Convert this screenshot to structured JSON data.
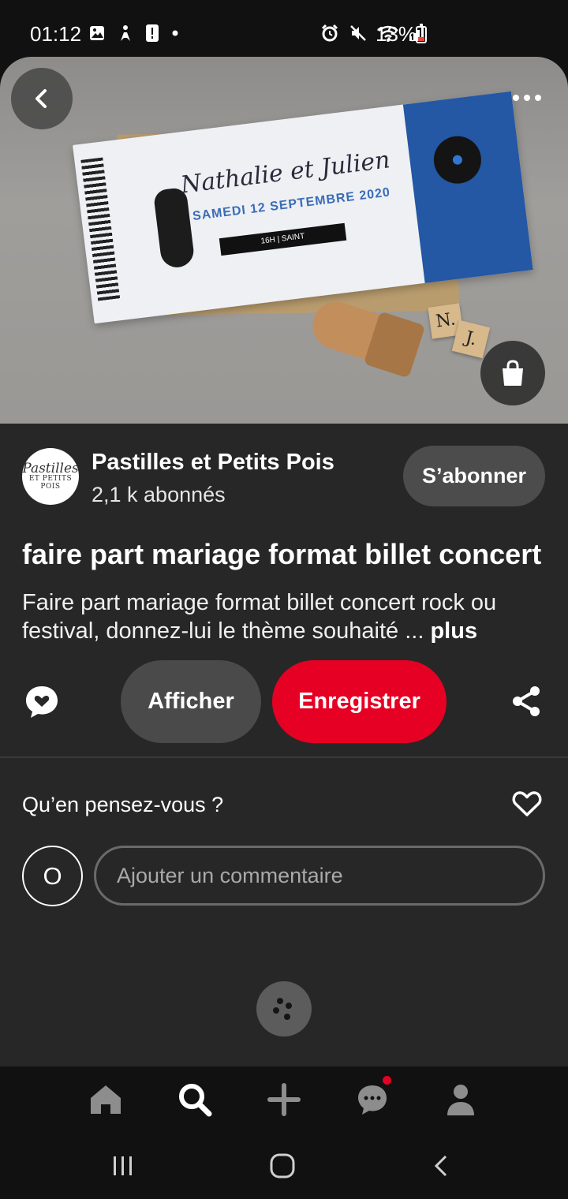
{
  "status_bar": {
    "time": "01:12",
    "battery_text": "13%",
    "battery_color": "#e2483f",
    "left_icons": [
      "gallery-icon",
      "accessibility-icon",
      "alert-icon",
      "dot-icon"
    ],
    "right_icons": [
      "alarm-icon",
      "mute-icon",
      "wifi-icon",
      "signal-icon",
      "battery-icon"
    ]
  },
  "hero": {
    "ticket_title": "Nathalie et Julien",
    "ticket_date": "SAMEDI 12 SEPTEMBRE 2020",
    "ticket_strip": "16H | SAINT",
    "tile_1": "N.",
    "tile_2": "J."
  },
  "creator": {
    "logo_line1": "Pastilles",
    "logo_line2": "ET PETITS POIS",
    "name": "Pastilles et Petits Pois",
    "followers": "2,1 k abonnés",
    "follow_label": "S’abonner"
  },
  "pin": {
    "title": "faire part mariage format billet concert",
    "description": "Faire part mariage format billet concert rock ou festival, donnez-lui le thème souhaité ...",
    "more_label": "plus"
  },
  "actions": {
    "view_label": "Afficher",
    "save_label": "Enregistrer"
  },
  "comments": {
    "question": "Qu’en pensez-vous ?",
    "avatar_initial": "O",
    "placeholder": "Ajouter un commentaire"
  },
  "colors": {
    "accent_red": "#e60023",
    "background": "#272727",
    "button_gray": "#4a4a4a"
  },
  "bottom_nav": [
    "home-icon",
    "search-icon",
    "add-icon",
    "messages-icon",
    "profile-icon"
  ]
}
